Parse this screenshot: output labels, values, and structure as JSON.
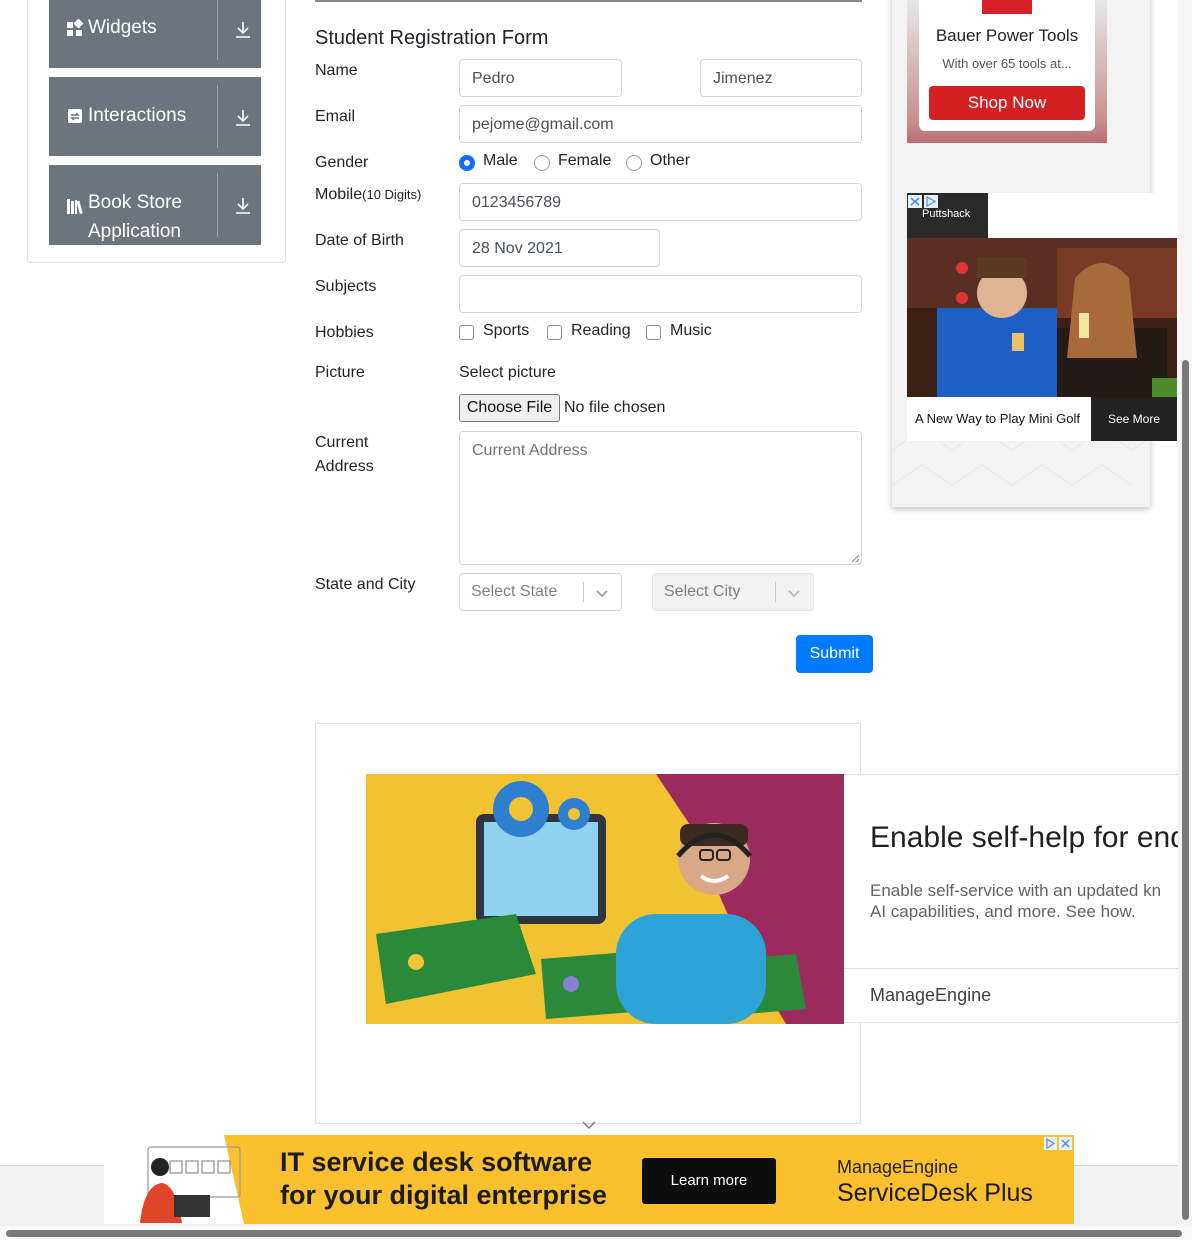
{
  "sidebar": {
    "groups": [
      {
        "label": "Widgets"
      },
      {
        "label": "Interactions"
      },
      {
        "label": "Book Store",
        "label2": "Application"
      }
    ]
  },
  "form": {
    "title": "Student Registration Form",
    "name_label": "Name",
    "first_name": "Pedro",
    "last_name": "Jimenez",
    "email_label": "Email",
    "email": "pejome@gmail.com",
    "gender_label": "Gender",
    "gender_options": [
      "Male",
      "Female",
      "Other"
    ],
    "gender_selected": "Male",
    "mobile_label": "Mobile",
    "mobile_hint": "(10 Digits)",
    "mobile": "0123456789",
    "dob_label": "Date of Birth",
    "dob": "28 Nov 2021",
    "subjects_label": "Subjects",
    "subjects": "",
    "hobbies_label": "Hobbies",
    "hobbies": [
      "Sports",
      "Reading",
      "Music"
    ],
    "picture_label": "Picture",
    "select_picture": "Select picture",
    "choose_file": "Choose File",
    "no_file": "No file chosen",
    "address_label1": "Current",
    "address_label2": "Address",
    "address_placeholder": "Current Address",
    "state_city_label": "State and City",
    "state_placeholder": "Select State",
    "city_placeholder": "Select City",
    "submit": "Submit"
  },
  "ads": {
    "bauer": {
      "title": "Bauer Power Tools",
      "subtitle": "With over 65 tools at...",
      "cta": "Shop Now"
    },
    "puttshack": {
      "brand": "Puttshack",
      "caption": "A New Way to Play Mini Golf",
      "cta": "See More"
    },
    "manageengine_mid": {
      "headline": "Enable self-help for end",
      "body1": "Enable self-service with an updated kn",
      "body2": "AI capabilities, and more. See how.",
      "brand": "ManageEngine"
    },
    "banner": {
      "line1": "IT service desk software",
      "line2": "for your digital enterprise",
      "cta": "Learn more",
      "brand": "ManageEngine",
      "product": "ServiceDesk Plus"
    }
  },
  "colors": {
    "sidebar_bg": "#6c757d",
    "submit_bg": "#007bff",
    "shop_now": "#d42020",
    "banner_bg": "#fbc02d"
  }
}
